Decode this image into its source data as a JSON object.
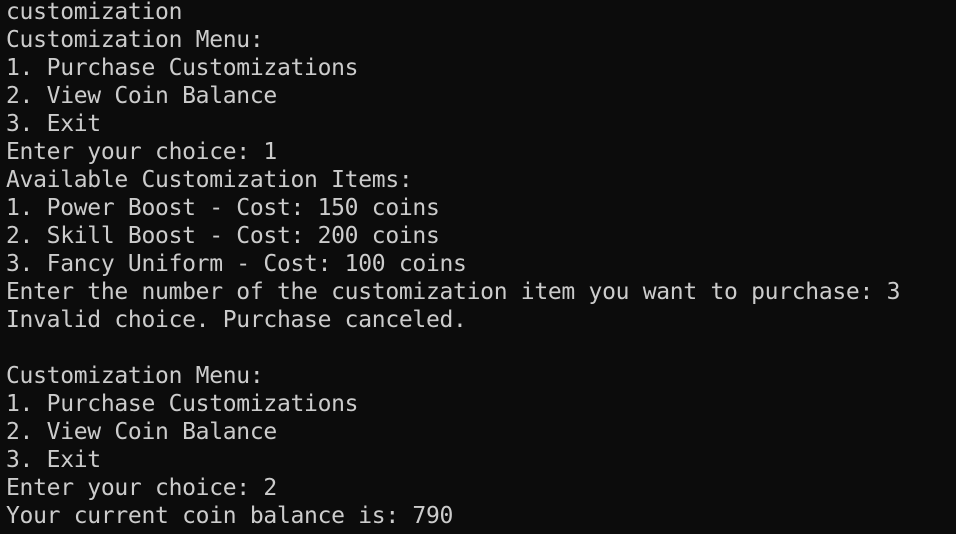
{
  "terminal": {
    "lines": [
      "customization",
      "Customization Menu:",
      "1. Purchase Customizations",
      "2. View Coin Balance",
      "3. Exit",
      "Enter your choice: 1",
      "Available Customization Items:",
      "1. Power Boost - Cost: 150 coins",
      "2. Skill Boost - Cost: 200 coins",
      "3. Fancy Uniform - Cost: 100 coins",
      "Enter the number of the customization item you want to purchase: 3",
      "Invalid choice. Purchase canceled.",
      "",
      "Customization Menu:",
      "1. Purchase Customizations",
      "2. View Coin Balance",
      "3. Exit",
      "Enter your choice: 2",
      "Your current coin balance is: 790"
    ]
  },
  "colors": {
    "background": "#0c0c0c",
    "foreground": "#cccccc"
  }
}
